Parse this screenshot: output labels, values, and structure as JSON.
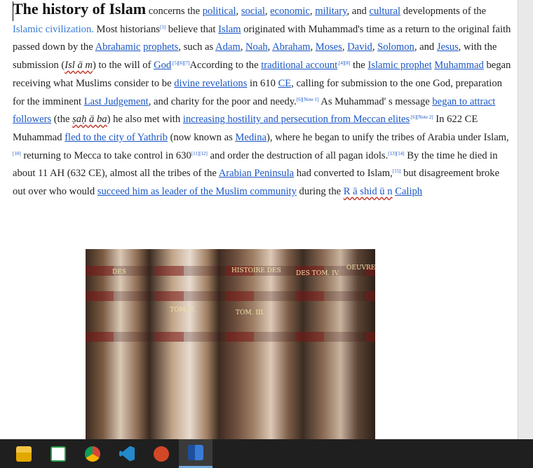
{
  "document": {
    "title": "The history of Islam",
    "paragraph": {
      "t1": " concerns the ",
      "political": "political",
      "comma1": ", ",
      "social": "social",
      "comma2": ", ",
      "economic": "economic",
      "comma3": ", ",
      "military": "military",
      "and1": ", and ",
      "cultural": "cultural",
      "t2": " developments of the ",
      "islamic_civ": "Islamic civilization.",
      "t3": " Most historians",
      "ref3": "[3]",
      "t4": " believe that ",
      "islam": "Islam",
      "t5": " originated with Muhammad's time as a return to the original faith passed down by the ",
      "abrahamic": "Abrahamic",
      "sp1": " ",
      "prophets": "prophets",
      "t6": ", such as ",
      "adam": "Adam",
      "c4": ", ",
      "noah": "Noah",
      "c5": ", ",
      "abraham": "Abraham",
      "c6": ", ",
      "moses": "Moses",
      "c7": ", ",
      "david": "David",
      "c8": ", ",
      "solomon": "Solomon",
      "and2": ", and ",
      "jesus": "Jesus",
      "t7": ", with the submission (",
      "islam_italic": "Isl ā m",
      "t8": ") to the will of ",
      "god": "God",
      "ref567": ".[5][6][7]",
      "t9": "According to the ",
      "trad": "traditional account",
      "ref48": ",[4][8]",
      "t10": " the ",
      "islamic_prophet": "Islamic prophet",
      "sp2": " ",
      "muhammad": "Muhammad",
      "t11": " began receiving what Muslims consider to be ",
      "divine": "divine revelations",
      "t12": " in 610 ",
      "ce": "CE",
      "t13": ", calling for submission to the one God, preparation for the imminent ",
      "last_judgement": "Last Judgement",
      "t14": ", and charity for the poor and needy.",
      "ref6n1": "[6][Note 1]",
      "t15": " As Muhammad' s message ",
      "began": "began to attract followers",
      "t16": " (the ",
      "sahaba": "ṣaḥ ā ba",
      "t17": ") he also met with ",
      "hostility": "increasing hostility and persecution from Meccan elites",
      "ref6n2": ".[6][Note 2]",
      "t18": " In 622 CE Muhammad ",
      "fled": "fled to the city of Yathrib",
      "t19": " (now known as ",
      "medina": "Medina",
      "t20": "), where he began to unify the tribes of Arabia under Islam,",
      "ref10": "[10]",
      "t21": " returning to Mecca to take control in 630",
      "ref1112": "[11][12]",
      "t22": " and order the destruction of all pagan idols.",
      "ref1314": "[13][14]",
      "t23": " By the time he died in about 11 AH (632 CE), almost all the tribes of the ",
      "arabian": "Arabian Peninsula",
      "t24": " had converted to Islam,",
      "ref15": "[15]",
      "t25": " but disagreement broke out over who would ",
      "succeed": "succeed him as leader of the Muslim community",
      "t26": " during the ",
      "rashidun": "R ā shid ū n",
      "sp3": " ",
      "caliph": "Caliph"
    },
    "image_alt_labels": [
      "DES",
      "TOM. II.",
      "HISTOIRE DES",
      "TOM. III.",
      "DES TOM. IV.",
      "OEUVRES"
    ]
  },
  "taskbar": {
    "apps": [
      "file-explorer",
      "visual-studio-code-insiders",
      "chrome",
      "visual-studio-code",
      "powerpoint",
      "word"
    ],
    "active": "word"
  },
  "colors": {
    "link": "#1a56c4",
    "taskbar": "#1f1f1f",
    "spellcheck": "#c0392b"
  }
}
